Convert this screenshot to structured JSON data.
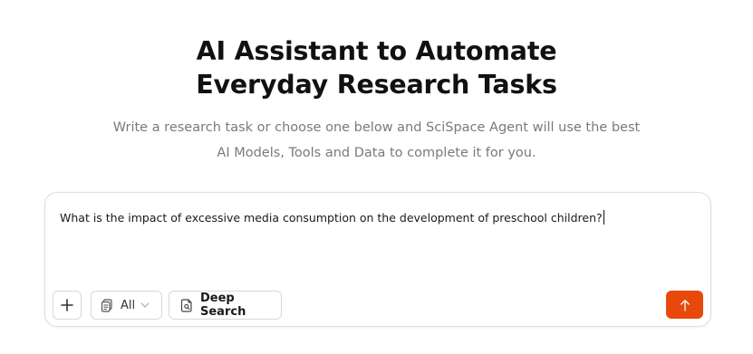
{
  "hero": {
    "title_line1": "AI Assistant to Automate",
    "title_line2": "Everyday Research Tasks",
    "subtitle_line1": "Write a research task or choose one below and SciSpace Agent will use the best",
    "subtitle_line2": "AI Models, Tools and Data to complete it for you."
  },
  "composer": {
    "prompt_value": "What is the impact of excessive media consumption on the development of preschool children?",
    "toolbar": {
      "add_icon": "plus-icon",
      "scope_icon": "documents-icon",
      "scope_selected": "All",
      "scope_chevron_icon": "chevron-down-icon",
      "deep_search_icon": "document-search-icon",
      "deep_search_label": "Deep Search"
    },
    "send_icon": "arrow-up-icon"
  },
  "colors": {
    "accent": "#e8490a",
    "subtitle_text": "#7a7a7a",
    "border": "#dedede"
  }
}
